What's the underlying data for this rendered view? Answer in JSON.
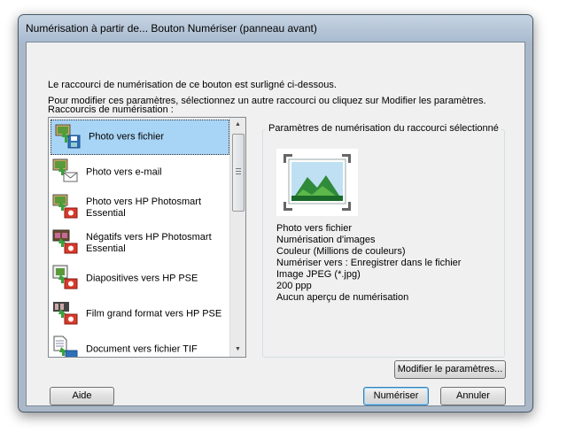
{
  "window": {
    "title": "Numérisation à partir de... Bouton Numériser (panneau avant)"
  },
  "intro": {
    "line1": "Le raccourci de numérisation de ce bouton est surligné ci-dessous.",
    "line2": "Pour modifier ces paramètres, sélectionnez un autre raccourci ou cliquez sur Modifier les paramètres."
  },
  "shortcuts": {
    "label": "Raccourcis de numérisation :",
    "items": [
      {
        "label": "Photo vers fichier",
        "icon": "photo-to-file-icon",
        "selected": true
      },
      {
        "label": "Photo vers e-mail",
        "icon": "photo-to-email-icon"
      },
      {
        "label": "Photo vers HP Photosmart Essential",
        "icon": "photo-to-hp-icon"
      },
      {
        "label": "Négatifs vers HP Photosmart Essential",
        "icon": "negatives-to-hp-icon"
      },
      {
        "label": "Diapositives vers HP PSE",
        "icon": "slides-to-hp-icon"
      },
      {
        "label": "Film grand format vers HP PSE",
        "icon": "large-film-to-hp-icon"
      },
      {
        "label": "Document vers fichier TIF",
        "icon": "document-to-tif-icon"
      }
    ]
  },
  "settings_group": {
    "legend": "Paramètres de numérisation du raccourci sélectionné",
    "details": [
      "Photo vers fichier",
      "Numérisation d'images",
      "Couleur (Millions de couleurs)",
      "Numériser vers : Enregistrer dans le fichier",
      "Image JPEG (*.jpg)",
      "200 ppp",
      "Aucun aperçu de numérisation"
    ]
  },
  "buttons": {
    "modify": "Modifier le paramètres...",
    "help": "Aide",
    "scan": "Numériser",
    "cancel": "Annuler"
  },
  "colors": {
    "selection": "#a8d4f5",
    "default_button_border": "#3c7fb1"
  }
}
